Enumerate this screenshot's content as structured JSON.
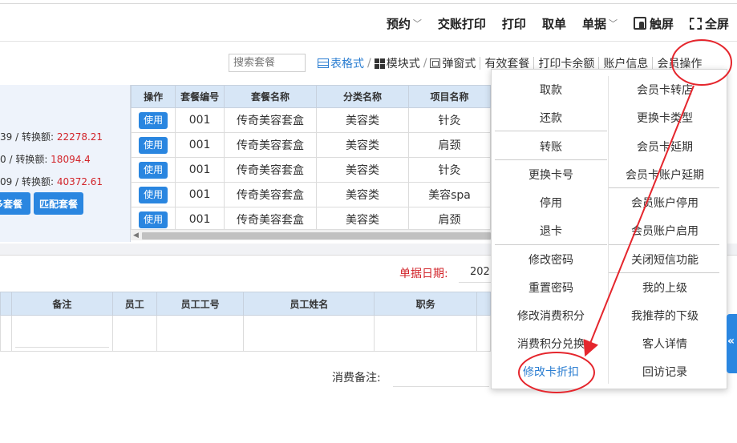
{
  "topnav": {
    "items": [
      {
        "label": "预约",
        "caret": true
      },
      {
        "label": "交账打印",
        "caret": false
      },
      {
        "label": "打印",
        "caret": false
      },
      {
        "label": "取单",
        "caret": false
      },
      {
        "label": "单据",
        "caret": true
      },
      {
        "label": "触屏",
        "caret": false,
        "icon": "touch-screen-icon"
      },
      {
        "label": "全屏",
        "caret": false,
        "icon": "fullscreen-icon"
      }
    ]
  },
  "toolbar": {
    "search_placeholder": "搜索套餐",
    "view_table": "表格式",
    "view_block": "模块式",
    "view_popup": "弹窗式",
    "valid_packages": "有效套餐",
    "print_balance": "打印卡余额",
    "account_info": "账户信息",
    "member_ops": "会员操作"
  },
  "info_panel": {
    "rows": [
      {
        "prefix": "39",
        "label": " / 转换额: ",
        "amount": "22278.21"
      },
      {
        "prefix": "0",
        "label": " / 转换额: ",
        "amount": "18094.4"
      },
      {
        "prefix": "09",
        "label": " / 转换额: ",
        "amount": "40372.61"
      }
    ],
    "btn_multi": "多套餐",
    "btn_match": "匹配套餐"
  },
  "package_table": {
    "headers": [
      "操作",
      "套餐编号",
      "套餐名称",
      "分类名称",
      "项目名称"
    ],
    "use_label": "使用",
    "rows": [
      {
        "code": "001",
        "name": "传奇美容套盒",
        "category": "美容类",
        "item": "针灸"
      },
      {
        "code": "001",
        "name": "传奇美容套盒",
        "category": "美容类",
        "item": "肩颈"
      },
      {
        "code": "001",
        "name": "传奇美容套盒",
        "category": "美容类",
        "item": "针灸"
      },
      {
        "code": "001",
        "name": "传奇美容套盒",
        "category": "美容类",
        "item": "美容spa"
      },
      {
        "code": "001",
        "name": "传奇美容套盒",
        "category": "美容类",
        "item": "肩颈"
      }
    ]
  },
  "bill": {
    "date_label": "单据日期:",
    "date_value": "202",
    "memo_label": "消费备注:"
  },
  "employee_table": {
    "headers": [
      "备注",
      "员工",
      "员工工号",
      "员工姓名",
      "职务"
    ]
  },
  "member_menu": {
    "left": [
      "取款",
      "还款",
      "转账",
      "更换卡号",
      "停用",
      "退卡",
      "修改密码",
      "重置密码",
      "修改消费积分",
      "消费积分兑换",
      "修改卡折扣"
    ],
    "right": [
      "会员卡转店",
      "更换卡类型",
      "会员卡延期",
      "会员卡账户延期",
      "会员账户停用",
      "会员账户启用",
      "关闭短信功能",
      "我的上级",
      "我推荐的下级",
      "客人详情",
      "回访记录"
    ]
  },
  "side_tab": {
    "label": "«"
  },
  "colors": {
    "accent": "#2a86e0",
    "annotation": "#e5262d",
    "amount": "#d2242a",
    "header_bg": "#d7e6f6"
  }
}
